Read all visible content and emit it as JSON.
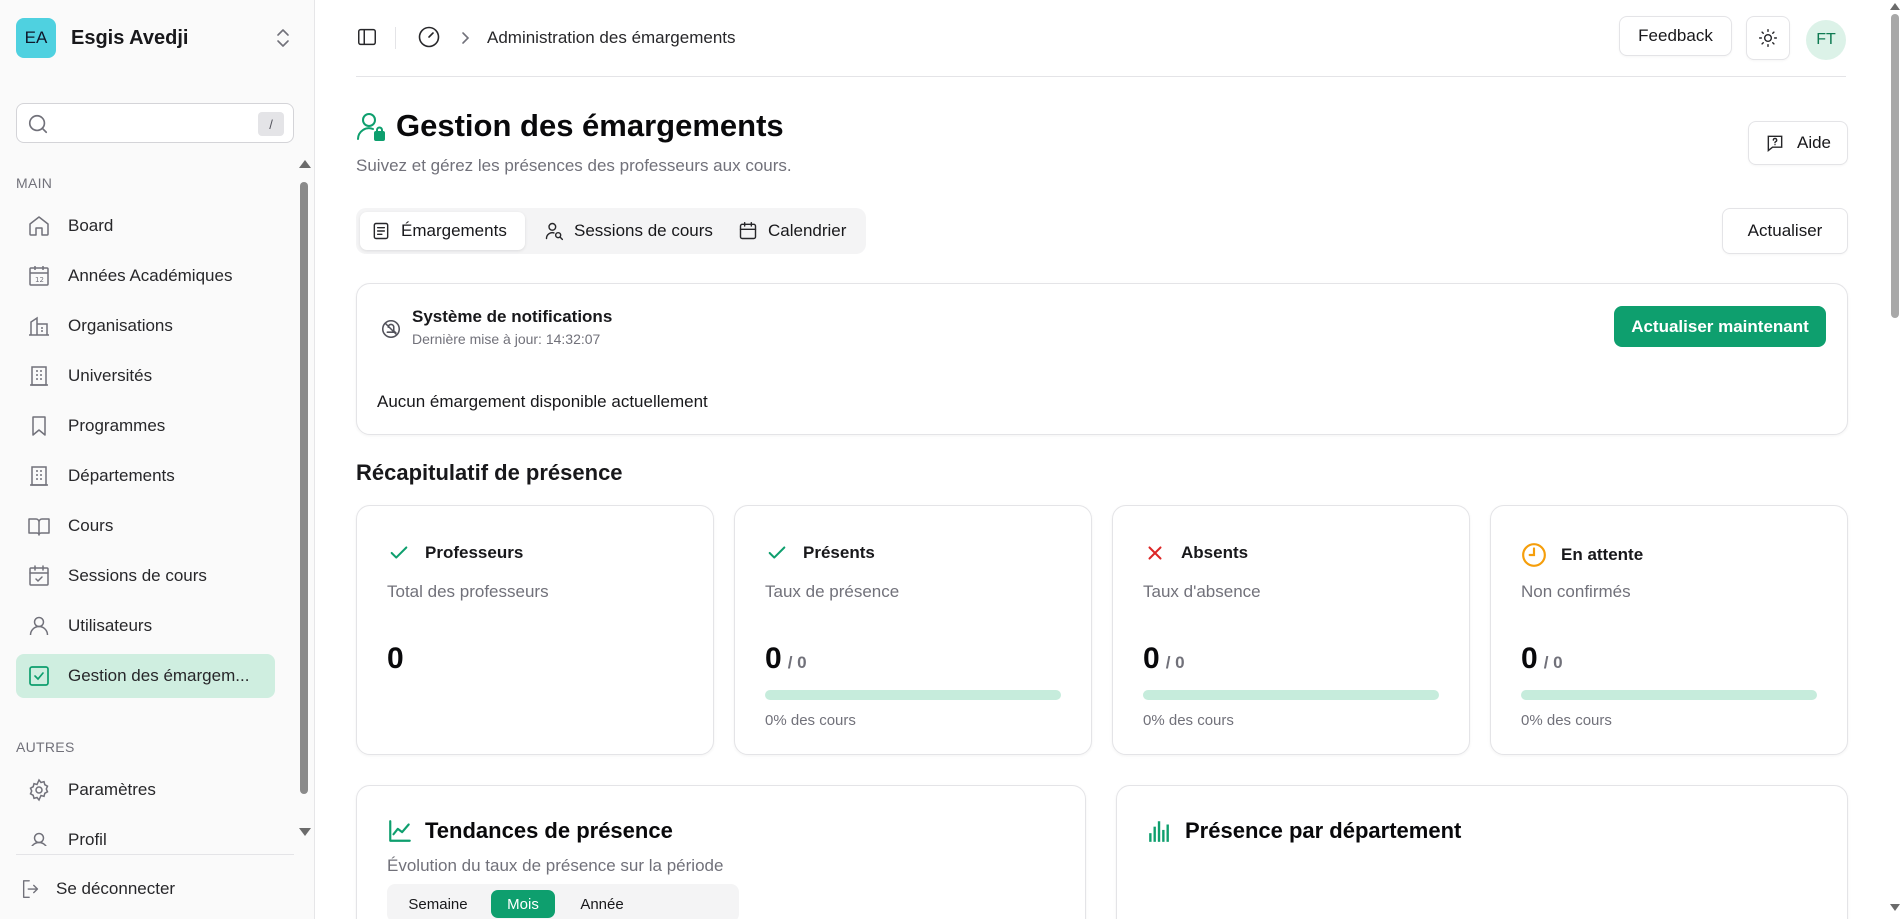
{
  "colors": {
    "accent": "#0e9f6e",
    "accent_light": "#cfeee0",
    "danger": "#dc2626",
    "warning": "#f59e0b"
  },
  "sidebar": {
    "workspace": {
      "initials": "EA",
      "name": "Esgis Avedji"
    },
    "search": {
      "placeholder": "",
      "shortcut": "/"
    },
    "main_label": "MAIN",
    "items": [
      {
        "label": "Board",
        "icon": "home-icon"
      },
      {
        "label": "Années Académiques",
        "icon": "calendar-icon"
      },
      {
        "label": "Organisations",
        "icon": "building-icon"
      },
      {
        "label": "Universités",
        "icon": "building-icon"
      },
      {
        "label": "Programmes",
        "icon": "bookmark-icon"
      },
      {
        "label": "Départements",
        "icon": "building-icon"
      },
      {
        "label": "Cours",
        "icon": "book-icon"
      },
      {
        "label": "Sessions de cours",
        "icon": "calendar-check-icon"
      },
      {
        "label": "Utilisateurs",
        "icon": "user-icon"
      },
      {
        "label": "Gestion des émargem...",
        "icon": "checkbox-icon",
        "active": true
      }
    ],
    "other_label": "AUTRES",
    "other_items": [
      {
        "label": "Paramètres",
        "icon": "gear-icon"
      },
      {
        "label": "Profil",
        "icon": "user-icon"
      }
    ],
    "logout": "Se déconnecter"
  },
  "topbar": {
    "breadcrumb": "Administration des émargements",
    "feedback": "Feedback",
    "avatar": "FT"
  },
  "page": {
    "title": "Gestion des émargements",
    "subtitle": "Suivez et gérez les présences des professeurs aux cours.",
    "help": "Aide",
    "refresh": "Actualiser",
    "tabs": [
      {
        "label": "Émargements",
        "icon": "list-icon",
        "active": true
      },
      {
        "label": "Sessions de cours",
        "icon": "user-search-icon"
      },
      {
        "label": "Calendrier",
        "icon": "calendar-icon"
      }
    ]
  },
  "notifications": {
    "title": "Système de notifications",
    "updated": "Dernière mise à jour: 14:32:07",
    "button": "Actualiser maintenant",
    "empty": "Aucun émargement disponible actuellement"
  },
  "summary": {
    "title": "Récapitulatif de présence",
    "cards": [
      {
        "title": "Professeurs",
        "desc": "Total des professeurs",
        "value": "0",
        "total": "",
        "pct": "",
        "progress": 0,
        "icon": "check-icon"
      },
      {
        "title": "Présents",
        "desc": "Taux de présence",
        "value": "0",
        "total": "/ 0",
        "pct": "0% des cours",
        "progress": 0,
        "icon": "check-icon"
      },
      {
        "title": "Absents",
        "desc": "Taux d'absence",
        "value": "0",
        "total": "/ 0",
        "pct": "0% des cours",
        "progress": 0,
        "icon": "x-icon"
      },
      {
        "title": "En attente",
        "desc": "Non confirmés",
        "value": "0",
        "total": "/ 0",
        "pct": "0% des cours",
        "progress": 0,
        "icon": "clock-icon"
      }
    ]
  },
  "trends": {
    "title": "Tendances de présence",
    "subtitle": "Évolution du taux de présence sur la période",
    "periods": [
      "Semaine",
      "Mois",
      "Année"
    ],
    "selected_period": "Mois"
  },
  "department": {
    "title": "Présence par département"
  }
}
